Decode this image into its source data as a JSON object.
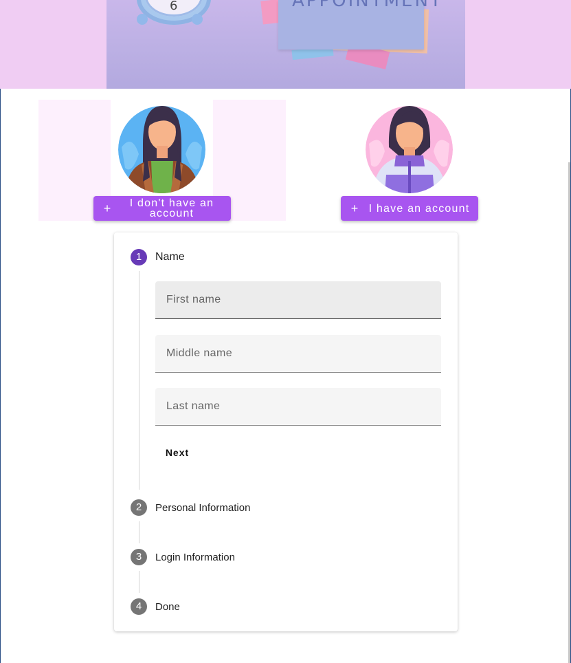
{
  "banner": {
    "clock_number": "6",
    "note_text": "APPOINTMENT"
  },
  "accounts": [
    {
      "label": "I don't have an account",
      "icon": "plus-icon",
      "plus": "+"
    },
    {
      "label": "I have an account",
      "icon": "plus-icon",
      "plus": "+"
    }
  ],
  "stepper": {
    "steps": [
      {
        "number": "1",
        "title": "Name",
        "state": "active"
      },
      {
        "number": "2",
        "title": "Personal Information",
        "state": "idle"
      },
      {
        "number": "3",
        "title": "Login Information",
        "state": "idle"
      },
      {
        "number": "4",
        "title": "Done",
        "state": "idle"
      }
    ],
    "fields": {
      "first_name": {
        "placeholder": "First name",
        "value": ""
      },
      "middle_name": {
        "placeholder": "Middle name",
        "value": ""
      },
      "last_name": {
        "placeholder": "Last name",
        "value": ""
      }
    },
    "next_label": "Next"
  },
  "colors": {
    "accent_button": "#a855f0",
    "active_step": "#673ab7",
    "idle_step": "#757575",
    "banner_bg": "#f0cdf3",
    "selected_card_bg": "#fdf0fd"
  }
}
